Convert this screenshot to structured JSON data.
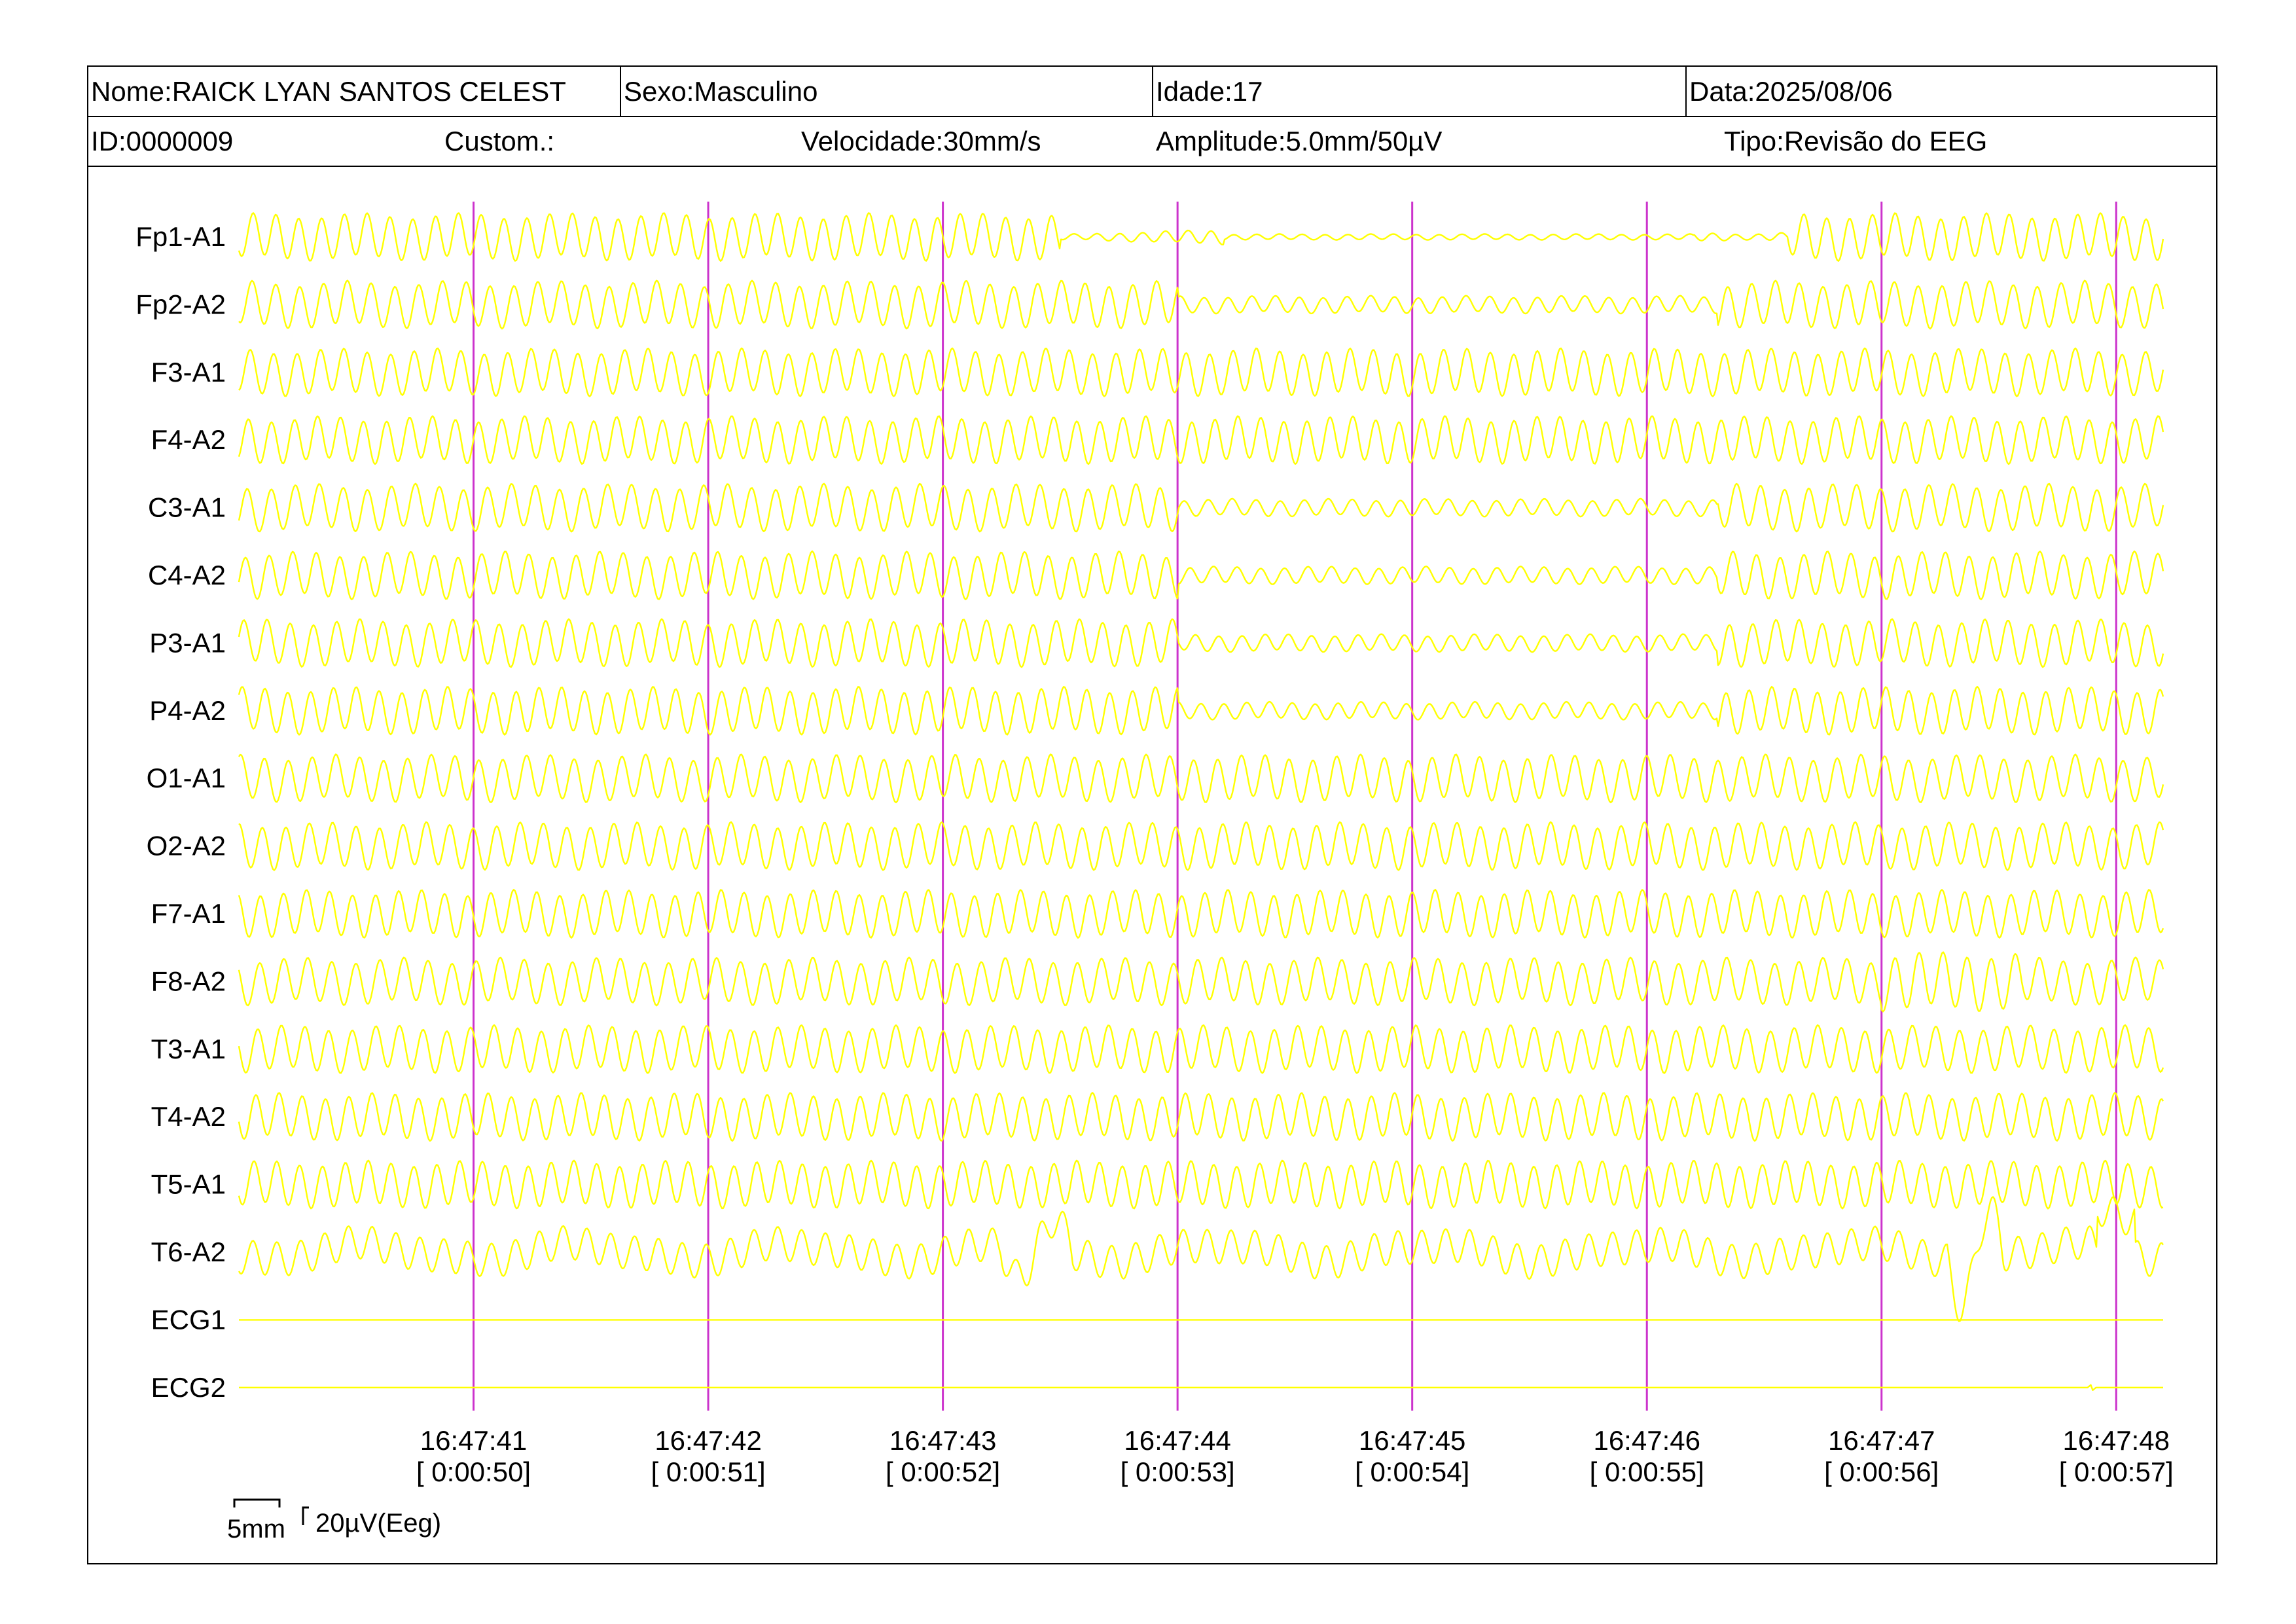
{
  "header": {
    "name": "Nome:RAICK LYAN SANTOS CELEST",
    "sex": "Sexo:Masculino",
    "age": "Idade:17",
    "date": "Data:2025/08/06",
    "id": "ID:0000009",
    "custom": "Custom.:",
    "speed": "Velocidade:30mm/s",
    "amplitude": "Amplitude:5.0mm/50µV",
    "type": "Tipo:Revisão do EEG"
  },
  "scale": {
    "time_label": "5mm",
    "amp_label": "20µV(Eeg)"
  },
  "colors": {
    "trace": "#ffff00",
    "second_marker": "#cc33cc",
    "text": "#000000"
  },
  "chart_data": {
    "type": "line",
    "channels": [
      "Fp1-A1",
      "Fp2-A2",
      "F3-A1",
      "F4-A2",
      "C3-A1",
      "C4-A2",
      "P3-A1",
      "P4-A2",
      "O1-A1",
      "O2-A2",
      "F7-A1",
      "F8-A2",
      "T3-A1",
      "T4-A2",
      "T5-A1",
      "T6-A2",
      "ECG1",
      "ECG2"
    ],
    "time_ticks": [
      {
        "clock": "16:47:41",
        "elapsed": "[ 0:00:50]"
      },
      {
        "clock": "16:47:42",
        "elapsed": "[ 0:00:51]"
      },
      {
        "clock": "16:47:43",
        "elapsed": "[ 0:00:52]"
      },
      {
        "clock": "16:47:44",
        "elapsed": "[ 0:00:53]"
      },
      {
        "clock": "16:47:45",
        "elapsed": "[ 0:00:54]"
      },
      {
        "clock": "16:47:46",
        "elapsed": "[ 0:00:55]"
      },
      {
        "clock": "16:47:47",
        "elapsed": "[ 0:00:56]"
      },
      {
        "clock": "16:47:48",
        "elapsed": "[ 0:00:57]"
      }
    ],
    "x_range_s": [
      49.0,
      57.2
    ],
    "approx_frequency_hz": 10,
    "amplitude_profile": {
      "Fp1-A1": "suppressed between 0:00:53 and 0:00:55",
      "ECG1": "flat",
      "ECG2": "flat"
    }
  }
}
